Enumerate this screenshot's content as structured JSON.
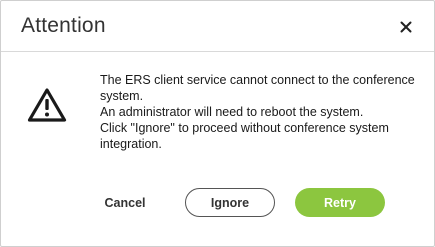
{
  "dialog": {
    "title": "Attention",
    "close_icon": "close-icon",
    "warning_icon": "warning-triangle-icon",
    "message_lines": [
      "The ERS client service cannot connect to the conference system.",
      "An administrator will need to reboot the system.",
      "Click \"Ignore\" to proceed without conference system integration."
    ]
  },
  "buttons": {
    "cancel_label": "Cancel",
    "ignore_label": "Ignore",
    "retry_label": "Retry"
  },
  "colors": {
    "accent": "#8cc63f",
    "title_text": "#333333",
    "body_text": "#1a1a1a"
  }
}
